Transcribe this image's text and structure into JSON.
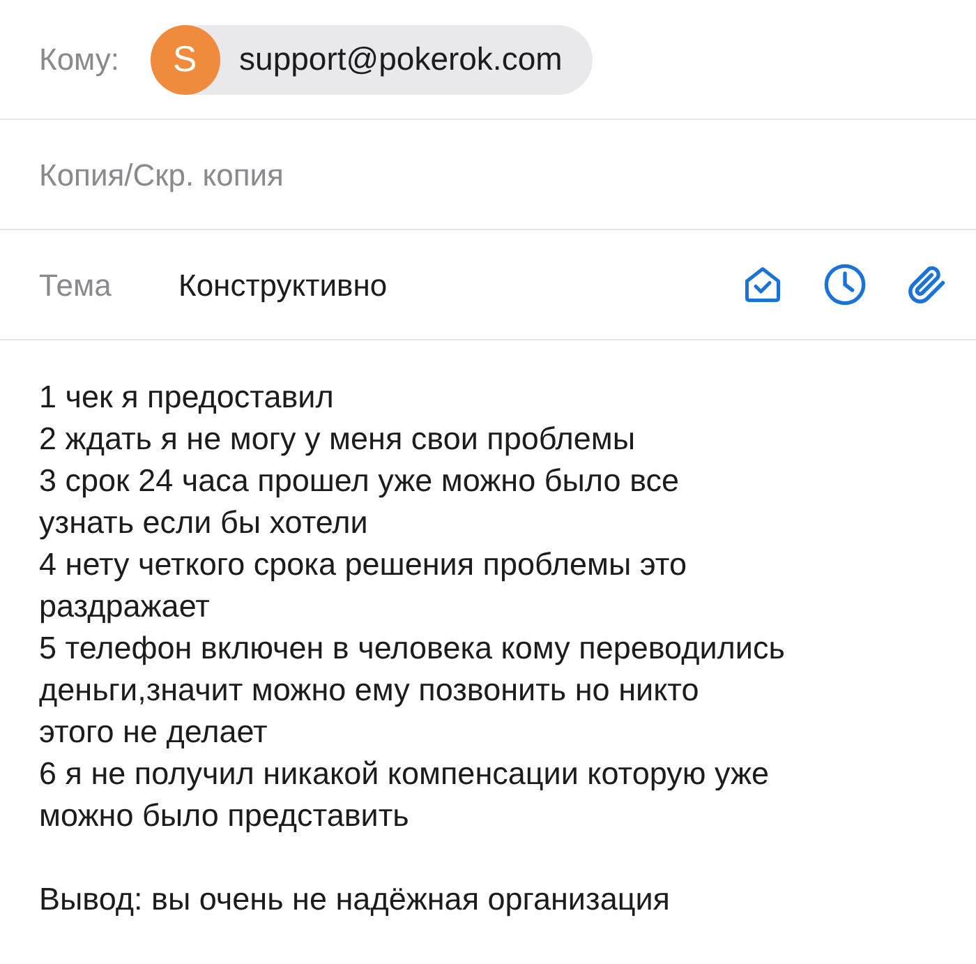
{
  "to": {
    "label": "Кому:",
    "recipient": {
      "initial": "S",
      "address": "support@pokerok.com",
      "color": "#f08a3c"
    }
  },
  "cc": {
    "placeholder": "Копия/Скр. копия"
  },
  "subject": {
    "label": "Тема",
    "value": "Конструктивно"
  },
  "body": {
    "blocks": [
      [
        "1 чек я предоставил",
        "2 ждать я не могу у меня свои проблемы",
        "3 срок 24 часа прошел уже можно было все",
        "узнать если бы хотели",
        "4 нету четкого срока решения проблемы это",
        "раздражает",
        "5 телефон включен в человека кому переводились",
        "деньги,значит можно ему позвонить но никто",
        "этого не делает",
        "6 я не получил никакой компенсации которую уже",
        "можно было представить"
      ],
      [
        "Вывод: вы очень не надёжная организация"
      ]
    ]
  }
}
